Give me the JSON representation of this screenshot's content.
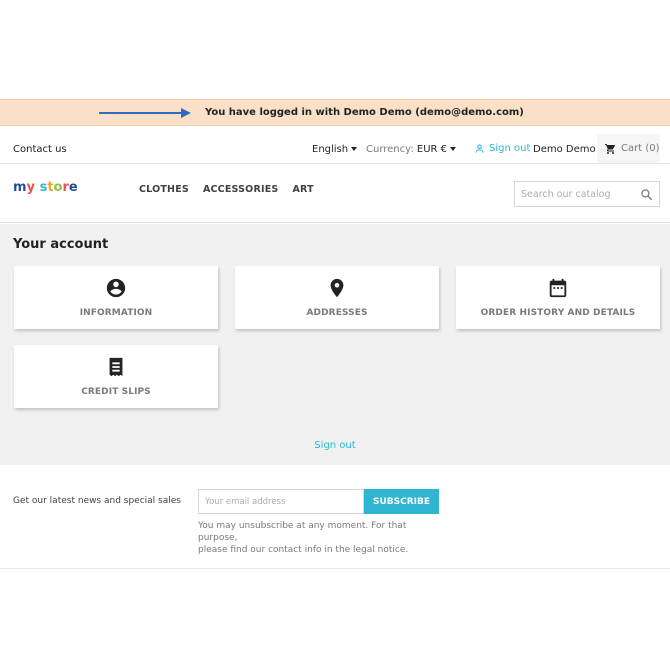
{
  "notice": {
    "text": "You have logged in with Demo Demo (demo@demo.com)"
  },
  "header": {
    "contact_label": "Contact us",
    "language": "English",
    "currency_label": "Currency:",
    "currency_value": "EUR €",
    "signout_label": "Sign out",
    "user_name": "Demo Demo",
    "cart_label": "Cart (0)"
  },
  "logo": {
    "text_parts": [
      "m",
      "y",
      " ",
      "s",
      "t",
      "o",
      "r",
      "e"
    ],
    "colors": [
      "#2d4a9a",
      "#f0504f",
      "",
      "#2fb5d2",
      "#f6a623",
      "#8bc34a",
      "#f0504f",
      "#2d4a9a"
    ]
  },
  "nav": {
    "items": [
      "CLOTHES",
      "ACCESSORIES",
      "ART"
    ]
  },
  "search": {
    "placeholder": "Search our catalog"
  },
  "account": {
    "title": "Your account",
    "tiles": [
      {
        "label": "INFORMATION",
        "icon": "account-circle-icon"
      },
      {
        "label": "ADDRESSES",
        "icon": "location-pin-icon"
      },
      {
        "label": "ORDER HISTORY AND DETAILS",
        "icon": "calendar-icon"
      },
      {
        "label": "CREDIT SLIPS",
        "icon": "receipt-icon"
      }
    ],
    "signout_label": "Sign out"
  },
  "newsletter": {
    "lead": "Get our latest news and special sales",
    "email_placeholder": "Your email address",
    "subscribe_label": "SUBSCRIBE",
    "note_line1": "You may unsubscribe at any moment. For that purpose,",
    "note_line2": "please find our contact info in the legal notice."
  },
  "colors": {
    "accent": "#2fb5d2",
    "link": "#24b9d7",
    "notice_bg": "#fbe0c8",
    "arrow": "#2e6cc4"
  }
}
